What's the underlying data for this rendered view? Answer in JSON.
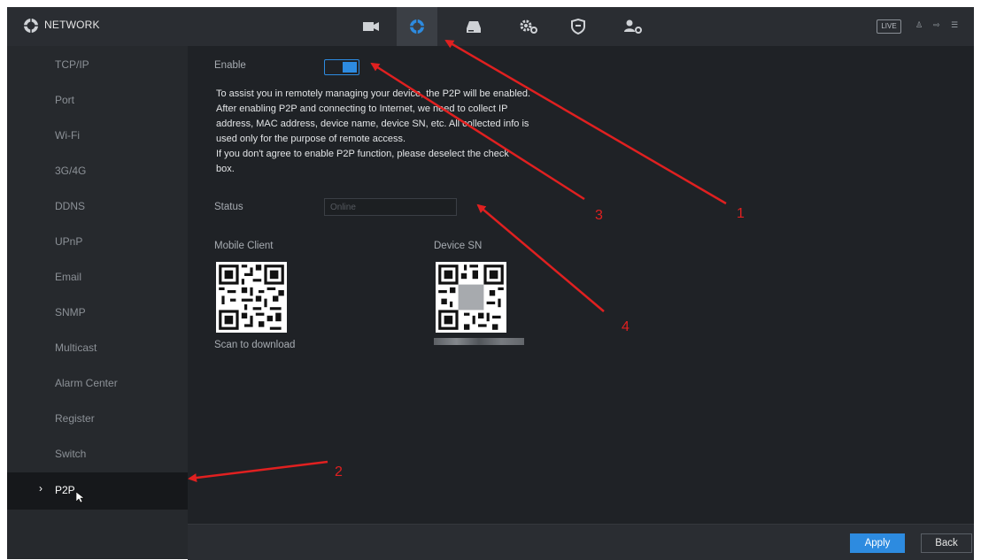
{
  "header": {
    "title": "NETWORK",
    "tabs": [
      {
        "icon": "camera-icon",
        "active": false
      },
      {
        "icon": "network-icon",
        "active": true
      },
      {
        "icon": "storage-icon",
        "active": false
      },
      {
        "icon": "settings-icon",
        "active": false
      },
      {
        "icon": "security-shield-icon",
        "active": false
      },
      {
        "icon": "account-icon",
        "active": false
      }
    ],
    "live_label": "LIVE",
    "right_icons": [
      "user-icon",
      "logout-icon",
      "menu-icon"
    ]
  },
  "sidebar": {
    "items": [
      {
        "label": "TCP/IP"
      },
      {
        "label": "Port"
      },
      {
        "label": "Wi-Fi"
      },
      {
        "label": "3G/4G"
      },
      {
        "label": "DDNS"
      },
      {
        "label": "UPnP"
      },
      {
        "label": "Email"
      },
      {
        "label": "SNMP"
      },
      {
        "label": "Multicast"
      },
      {
        "label": "Alarm Center"
      },
      {
        "label": "Register"
      },
      {
        "label": "Switch"
      },
      {
        "label": "P2P",
        "active": true
      }
    ],
    "active_chevron": "›"
  },
  "main": {
    "enable_label": "Enable",
    "enable_checked": true,
    "description": [
      "To assist you in remotely managing your device, the P2P will be enabled.",
      " After enabling P2P and connecting to Internet, we need to collect IP",
      "address, MAC address, device name, device SN, etc. All collected info is",
      "used only for the purpose of remote access.",
      "If you don't agree to enable P2P function, please deselect the check",
      "box."
    ],
    "status_label": "Status",
    "status_value": "Online",
    "mobile_client_label": "Mobile Client",
    "scan_label": "Scan to download",
    "device_sn_label": "Device SN"
  },
  "footer": {
    "apply_label": "Apply",
    "back_label": "Back"
  },
  "annotations": {
    "color": "#e02020",
    "numbers": [
      "1",
      "2",
      "3",
      "4"
    ]
  },
  "colors": {
    "accent": "#2d8be0",
    "background": "#1f2226",
    "sidebar": "#26292d",
    "active_item": "#16181b"
  }
}
